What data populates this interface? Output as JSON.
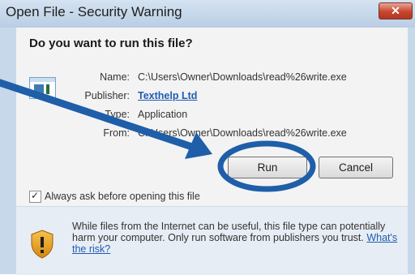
{
  "window": {
    "title": "Open File - Security Warning",
    "close_glyph": "✕"
  },
  "dialog": {
    "question": "Do you want to run this file?",
    "fields": {
      "name": {
        "label": "Name:",
        "value": "C:\\Users\\Owner\\Downloads\\read%26write.exe"
      },
      "publisher": {
        "label": "Publisher:",
        "value": "Texthelp Ltd"
      },
      "type": {
        "label": "Type:",
        "value": "Application"
      },
      "from": {
        "label": "From:",
        "value": "C:\\Users\\Owner\\Downloads\\read%26write.exe"
      }
    },
    "buttons": {
      "run": "Run",
      "cancel": "Cancel"
    },
    "checkbox": {
      "label": "Always ask before opening this file",
      "checked": true
    },
    "warning": {
      "text": "While files from the Internet can be useful, this file type can potentially harm your computer. Only run software from publishers you trust.",
      "link": "What's the risk?"
    }
  },
  "icons": {
    "file": "application-icon",
    "shield": "security-shield-icon"
  },
  "colors": {
    "annotation": "#1f5ea8",
    "accent_link": "#1e5bb3",
    "close_button": "#c9452e"
  }
}
